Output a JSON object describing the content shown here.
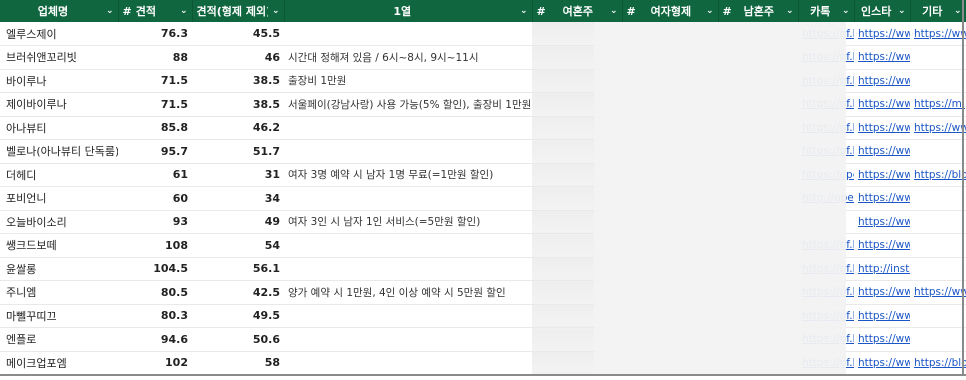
{
  "headers": {
    "company": "업체명",
    "quote": "견적",
    "quote_ex": "견적(형제 제외)",
    "group1": "1열",
    "women_total": "여혼주",
    "women_sibling": "여자형제",
    "men_total": "남혼주",
    "kakao": "카톡",
    "insta": "인스타",
    "etc": "기타",
    "hash": "#",
    "chevron": "⌄"
  },
  "rows": [
    {
      "company": "엘루스제이",
      "quote": "76.3",
      "quote_ex": "45.5",
      "memo": "",
      "kakao": "https://pf.k",
      "insta": "https://ww",
      "etc": "https://ww"
    },
    {
      "company": "브러쉬앤꼬리빗",
      "quote": "88",
      "quote_ex": "46",
      "memo": "시간대 정해져 있음  / 6시~8시, 9시~11시",
      "kakao": "https://pf.k",
      "insta": "https://ww",
      "etc": ""
    },
    {
      "company": "바이루나",
      "quote": "71.5",
      "quote_ex": "38.5",
      "memo": "출장비 1만원",
      "kakao": "https://pf.k",
      "insta": "https://ww",
      "etc": ""
    },
    {
      "company": "제이바이루나",
      "quote": "71.5",
      "quote_ex": "38.5",
      "memo": "서울페이(강남사랑) 사용 가능(5% 할인), 출장비 1만원",
      "kakao": "https://pf.k",
      "insta": "https://ww",
      "etc": "https://m.p"
    },
    {
      "company": "아나뷰티",
      "quote": "85.8",
      "quote_ex": "46.2",
      "memo": "",
      "kakao": "https://pf.k",
      "insta": "https://ww",
      "etc": "https://ww"
    },
    {
      "company": "벨로나(아나뷰티 단독룸)",
      "quote": "95.7",
      "quote_ex": "51.7",
      "memo": "",
      "kakao": "https://pf.k",
      "insta": "https://ww",
      "etc": ""
    },
    {
      "company": "더헤디",
      "quote": "61",
      "quote_ex": "31",
      "memo": "여자 3명 예약 시 남자 1명 무료(=1만원 할인)",
      "kakao": "https://ope",
      "insta": "https://ww",
      "etc": "https://blo"
    },
    {
      "company": "포비언니",
      "quote": "60",
      "quote_ex": "34",
      "memo": "",
      "kakao": "http://open",
      "insta": "https://ww",
      "etc": ""
    },
    {
      "company": "오늘바이소리",
      "quote": "93",
      "quote_ex": "49",
      "memo": "여자 3인 시 남자 1인 서비스(=5만원 할인)",
      "kakao": "",
      "insta": "https://ww",
      "etc": ""
    },
    {
      "company": "쌩크드보떼",
      "quote": "108",
      "quote_ex": "54",
      "memo": "",
      "kakao": "https://pf.k",
      "insta": "https://ww",
      "etc": ""
    },
    {
      "company": "윤쌀롱",
      "quote": "104.5",
      "quote_ex": "56.1",
      "memo": "",
      "kakao": "https://pf.k",
      "insta": "http://insta",
      "etc": ""
    },
    {
      "company": "주니엠",
      "quote": "80.5",
      "quote_ex": "42.5",
      "memo": "양가 예약 시 1만원, 4인 이상 예약 시 5만원 할인",
      "kakao": "https://pf.k",
      "insta": "https://ww",
      "etc": "https://ww"
    },
    {
      "company": "마뻴꾸띠끄",
      "quote": "80.3",
      "quote_ex": "49.5",
      "memo": "",
      "kakao": "https://pf.k",
      "insta": "https://ww",
      "etc": ""
    },
    {
      "company": "엔플로",
      "quote": "94.6",
      "quote_ex": "50.6",
      "memo": "",
      "kakao": "https://pf.k",
      "insta": "https://ww",
      "etc": ""
    },
    {
      "company": "메이크업포엠",
      "quote": "102",
      "quote_ex": "58",
      "memo": "",
      "kakao": "https://pf.k",
      "insta": "https://ww",
      "etc": "https://blo"
    }
  ]
}
